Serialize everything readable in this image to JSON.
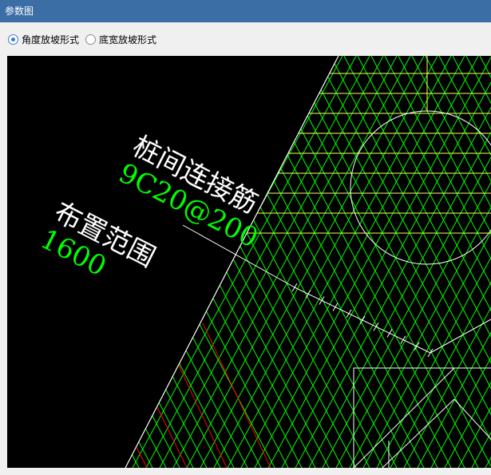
{
  "window": {
    "title": "参数图"
  },
  "options": {
    "angle_mode_label": "角度放坡形式",
    "width_mode_label": "底宽放坡形式",
    "selected": "angle_mode"
  },
  "drawing": {
    "annotation_title_1": "桩间连接筋",
    "annotation_value_1": "9C20@200",
    "annotation_title_2": "布置范围",
    "annotation_value_2": "1600",
    "colors": {
      "background": "#000000",
      "boundary": "#ffffff",
      "mesh_green": "#00ff00",
      "mesh_yellow": "#ffff66",
      "rebar_red": "#ff0000",
      "label_white": "#ffffff",
      "label_green": "#00ff00"
    }
  }
}
